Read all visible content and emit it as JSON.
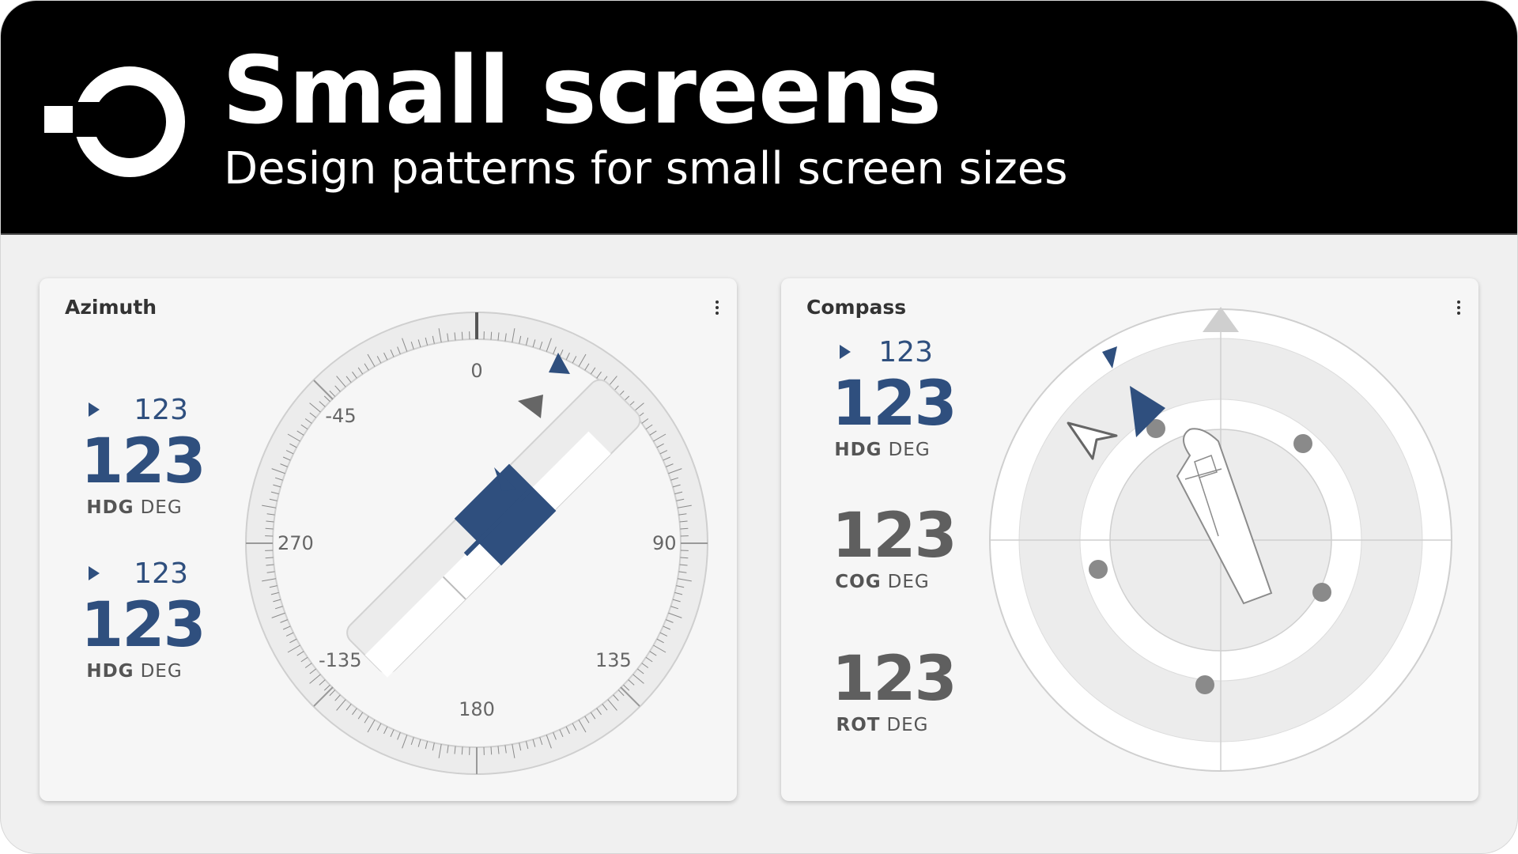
{
  "header": {
    "title": "Small screens",
    "subtitle": "Design patterns for small screen sizes",
    "logo_icon": "openbridge-logo-icon"
  },
  "azimuth_card": {
    "title": "Azimuth",
    "menu_icon": "kebab-menu-icon",
    "readouts": [
      {
        "setpoint": "123",
        "value": "123",
        "label": "HDG",
        "unit": "DEG"
      },
      {
        "setpoint": "123",
        "value": "123",
        "label": "HDG",
        "unit": "DEG"
      }
    ],
    "dial_labels": {
      "top": "0",
      "minus45": "-45",
      "left": "270",
      "right": "90",
      "bottom_right": "135",
      "bottom": "180",
      "bottom_left": "-135"
    }
  },
  "compass_card": {
    "title": "Compass",
    "menu_icon": "kebab-menu-icon",
    "readouts": [
      {
        "setpoint": "123",
        "value": "123",
        "label": "HDG",
        "unit": "DEG"
      },
      {
        "value": "123",
        "label": "COG",
        "unit": "DEG"
      },
      {
        "value": "123",
        "label": "ROT",
        "unit": "DEG"
      }
    ]
  },
  "colors": {
    "accent_blue": "#2f4f7e",
    "banner_bg": "#000000",
    "panel_bg": "#f6f6f6",
    "page_bg": "#f0f0f0"
  }
}
